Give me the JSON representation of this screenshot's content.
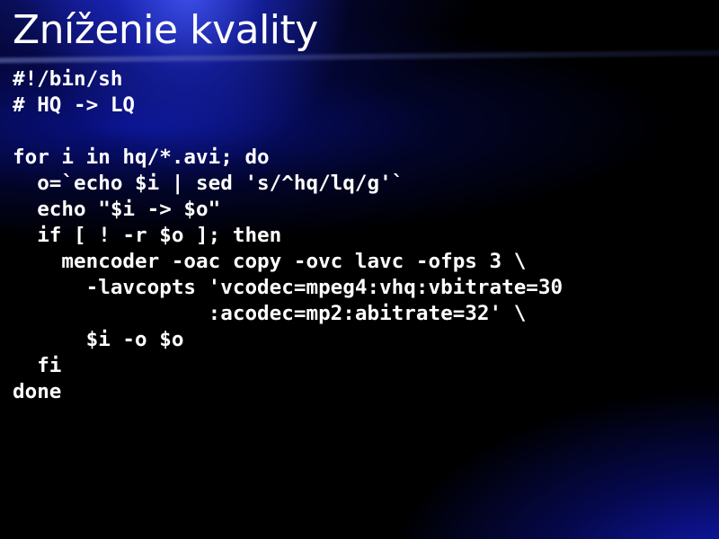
{
  "slide": {
    "title": "Zníženie kvality",
    "code_lines": [
      "#!/bin/sh",
      "# HQ -> LQ",
      "",
      "for i in hq/*.avi; do",
      "  o=`echo $i | sed 's/^hq/lq/g'`",
      "  echo \"$i -> $o\"",
      "  if [ ! -r $o ]; then",
      "    mencoder -oac copy -ovc lavc -ofps 3 \\",
      "      -lavcopts 'vcodec=mpeg4:vhq:vbitrate=30",
      "                :acodec=mp2:abitrate=32' \\",
      "      $i -o $o",
      "  fi",
      "done"
    ]
  },
  "colors": {
    "text": "#ffffff",
    "background": "#000000",
    "accent_blue": "#1e2dd2"
  }
}
